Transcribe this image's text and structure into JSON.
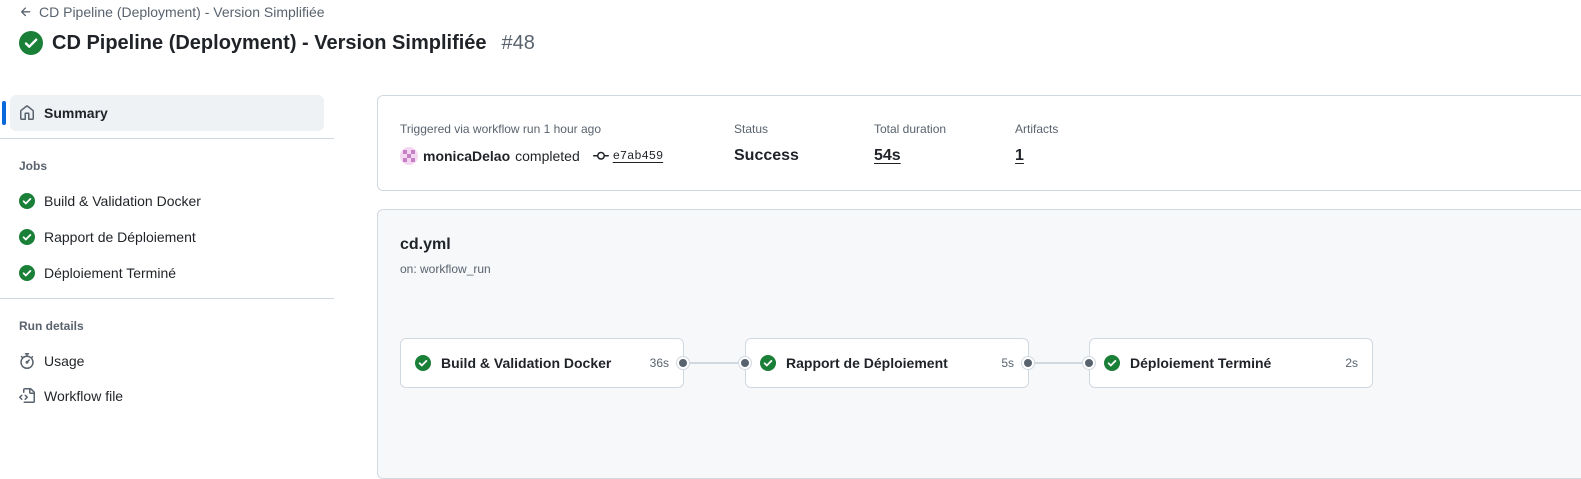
{
  "header": {
    "back_label": "CD Pipeline (Deployment) - Version Simplifiée",
    "title": "CD Pipeline (Deployment) - Version Simplifiée",
    "run_number": "#48"
  },
  "sidebar": {
    "summary_label": "Summary",
    "jobs_heading": "Jobs",
    "jobs": [
      {
        "label": "Build & Validation Docker"
      },
      {
        "label": "Rapport de Déploiement"
      },
      {
        "label": "Déploiement Terminé"
      }
    ],
    "run_details_heading": "Run details",
    "usage_label": "Usage",
    "workflow_file_label": "Workflow file"
  },
  "summary": {
    "trigger_label": "Triggered via workflow run 1 hour ago",
    "actor": "monicaDelao",
    "action": "completed",
    "commit": "e7ab459",
    "status_label": "Status",
    "status_value": "Success",
    "duration_label": "Total duration",
    "duration_value": "54s",
    "artifacts_label": "Artifacts",
    "artifacts_value": "1"
  },
  "workflow": {
    "file": "cd.yml",
    "trigger": "on: workflow_run",
    "jobs": [
      {
        "name": "Build & Validation Docker",
        "duration": "36s"
      },
      {
        "name": "Rapport de Déploiement",
        "duration": "5s"
      },
      {
        "name": "Déploiement Terminé",
        "duration": "2s"
      }
    ]
  },
  "colors": {
    "success": "#1a7f37",
    "accent": "#0969da",
    "muted": "#59636e",
    "border": "#d1d9e0"
  },
  "icons": {
    "back": "arrow-left-icon",
    "success": "check-circle-fill-icon",
    "summary": "home-icon",
    "usage": "stopwatch-icon",
    "workflow_file": "file-code-icon",
    "commit": "git-commit-icon"
  }
}
